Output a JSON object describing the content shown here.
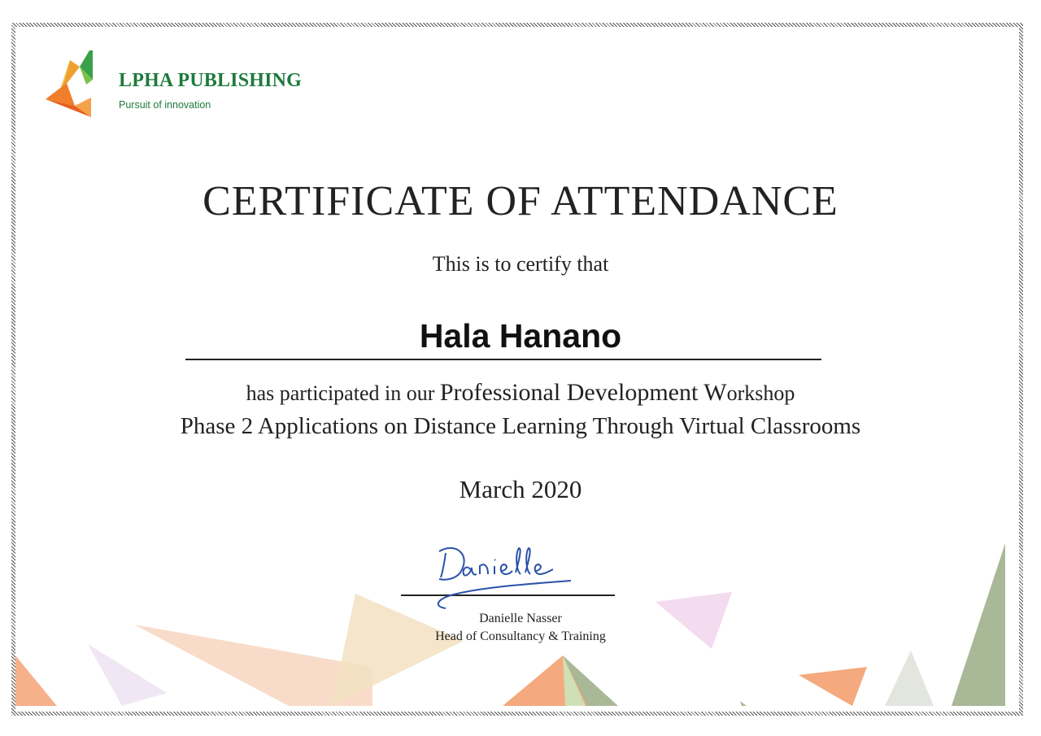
{
  "brand": {
    "name": "LPHA PUBLISHING",
    "tagline": "Pursuit of innovation",
    "color": "#1e7a3c"
  },
  "certificate": {
    "title": "CERTIFICATE OF ATTENDANCE",
    "intro": "This is to certify that",
    "recipient": "Hala Hanano",
    "participation_prefix": "has participated in our ",
    "program_part1": "Professional Development W",
    "program_part2": "orkshop",
    "program_title": "Phase 2 Applications on Distance Learning Through Virtual Classrooms",
    "date": "March 2020"
  },
  "signatory": {
    "signature_text": "Danielle",
    "name": "Danielle Nasser",
    "role": "Head of Consultancy & Training",
    "ink_color": "#2a52a8"
  },
  "decor_colors": {
    "orange": "#f5a97e",
    "peach": "#f7d6c0",
    "sand": "#f3e2c2",
    "lavender": "#f1e6f3",
    "pink": "#f3dcef",
    "olive": "#a9b897",
    "light_green": "#cfe0b5",
    "grey": "#e3e6df"
  }
}
